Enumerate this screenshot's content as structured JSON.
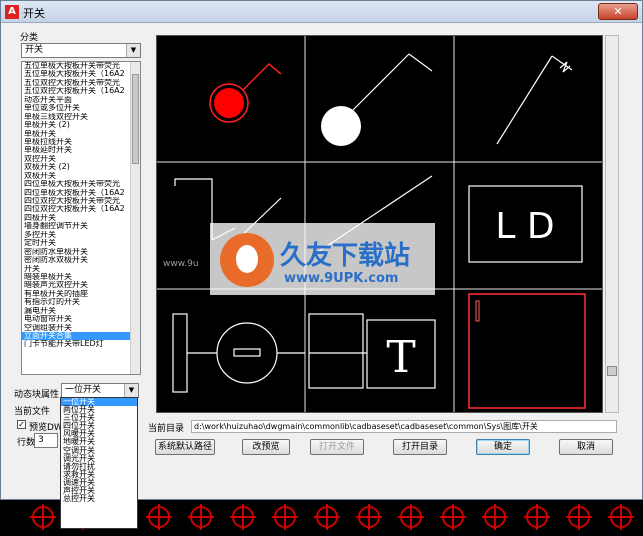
{
  "window": {
    "title": "开关",
    "close_label": "✕"
  },
  "category": {
    "label": "分类",
    "selected": "开关"
  },
  "list_items": [
    "五位单极大按板开关带荧光",
    "五位单极大按板开关（16A2",
    "五位双控大按板开关带荧光",
    "五位双控大按板开关（16A2",
    "动态开关平面",
    "单位或多位开关",
    "单极三线双控开关",
    "单极开关 (2)",
    "单极开关",
    "单极拉线开关",
    "单极延时开关",
    "双控开关",
    "双极开关 (2)",
    "双极开关",
    "四位单极大按板开关带荧光",
    "四位单极大按板开关（16A2",
    "四位双控大按板开关带荧光",
    "四位双控大按板开关（16A2",
    "四极开关",
    "墙身翻控调节开关",
    "多控开关",
    "定时开关",
    "密闭防水单极开关",
    "密闭防水双极开关",
    "开关",
    "暗装单极开关",
    "暗装声光双控开关",
    "有单极开关的插座",
    "有指示灯的开关",
    "漏电开关",
    "电动窗帘开关",
    "空调组装开关",
    "立面开关合集",
    "门卡节能开关带LED灯"
  ],
  "selected_list_index": 32,
  "dynamic_attr": {
    "label": "动态块属性",
    "selected": "一位开关"
  },
  "dropdown_options": [
    "一位开关",
    "两位开关",
    "三位开关",
    "四位开关",
    "风暖开关",
    "地暖开关",
    "空调开关",
    "调光开关",
    "请勿打扰",
    "求救开关",
    "调速开关",
    "声控开关",
    "总控开关"
  ],
  "selected_option_index": 0,
  "current_file": {
    "label": "当前文件"
  },
  "preview_check": {
    "label": "预览DWG",
    "checked": "✓"
  },
  "row_count": {
    "label": "行数",
    "value": "3"
  },
  "current_dir": {
    "label": "当前目录",
    "path": "d:\\work\\huizuhao\\dwgmain\\commonlib\\cadbaseset\\cadbaseset\\common\\Sys\\图库\\开关"
  },
  "buttons": {
    "default_path": "系统默认路径",
    "change_preview": "改预览",
    "open_file": "打开文件",
    "open_dir": "打开目录",
    "ok": "确定",
    "cancel": "取消"
  },
  "preview_texts": {
    "ld": "L D",
    "t": "T"
  },
  "watermark": {
    "cn": "久友下载站",
    "en": "www.9UPK.com",
    "left": "www.9u"
  },
  "colors": {
    "accent_red": "#ff0000",
    "selection": "#3399ff",
    "cad_red": "#cc0000"
  }
}
